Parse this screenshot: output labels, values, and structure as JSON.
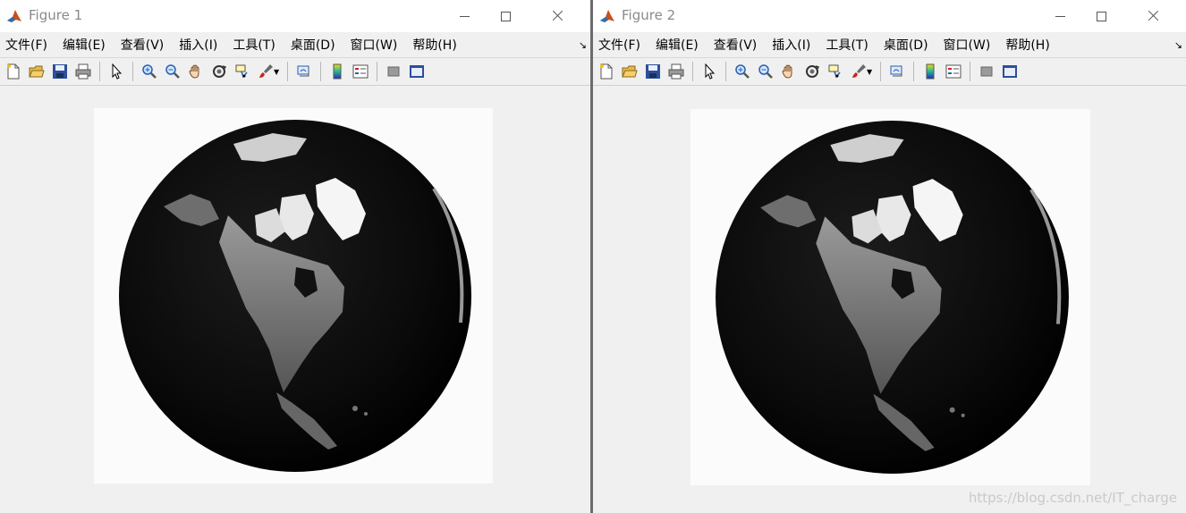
{
  "windows": [
    {
      "title": "Figure 1",
      "menu": [
        "文件(F)",
        "编辑(E)",
        "查看(V)",
        "插入(I)",
        "工具(T)",
        "桌面(D)",
        "窗口(W)",
        "帮助(H)"
      ]
    },
    {
      "title": "Figure 2",
      "menu": [
        "文件(F)",
        "编辑(E)",
        "查看(V)",
        "插入(I)",
        "工具(T)",
        "桌面(D)",
        "窗口(W)",
        "帮助(H)"
      ]
    }
  ],
  "toolbar_icons": [
    "new-figure-icon",
    "open-file-icon",
    "save-icon",
    "print-icon",
    "edit-plot-arrow-icon",
    "zoom-in-icon",
    "zoom-out-icon",
    "pan-hand-icon",
    "rotate-3d-icon",
    "data-cursor-icon",
    "brush-icon",
    "link-plot-icon",
    "colorbar-icon",
    "legend-icon",
    "hide-plot-tools-icon",
    "show-plot-tools-icon"
  ],
  "colors": {
    "window_bg": "#f0f0f0",
    "titlebar_bg": "#ffffff",
    "axes_bg": "#fbfbfb",
    "globe_dark": "#0a0a0a",
    "land": "#7a7a7a",
    "ice": "#f5f5f5"
  },
  "watermark": "https://blog.csdn.net/IT_charge"
}
